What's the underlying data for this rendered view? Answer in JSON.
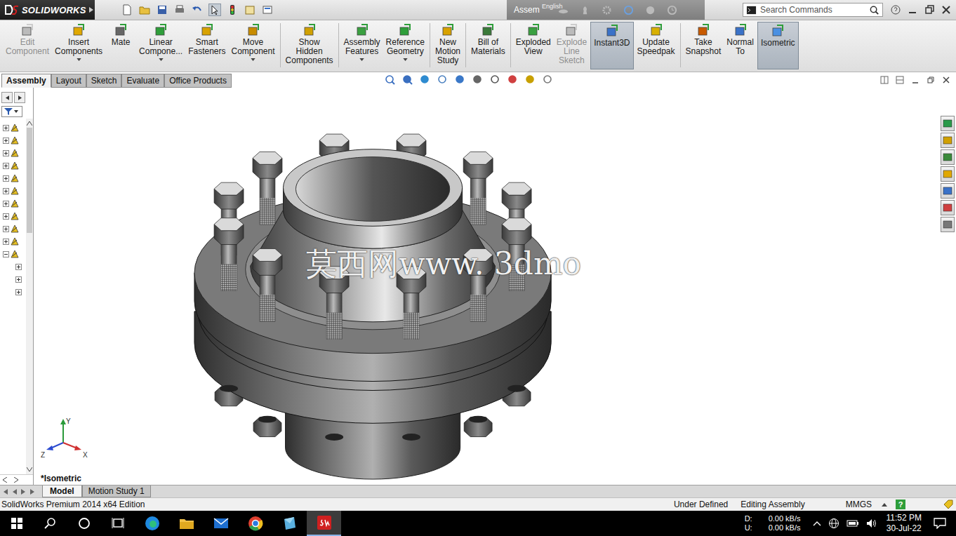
{
  "app": {
    "logo": "SOLIDWORKS",
    "title": "Assem",
    "language_tip": "English",
    "search_placeholder": "Search Commands"
  },
  "commands": [
    {
      "label": "Edit\nComponent",
      "disabled": true,
      "selected": false,
      "dropdown": false,
      "separator_before": false
    },
    {
      "label": "Insert\nComponents",
      "disabled": false,
      "selected": false,
      "dropdown": true,
      "separator_before": false
    },
    {
      "label": "Mate",
      "disabled": false,
      "selected": false,
      "dropdown": false,
      "separator_before": false
    },
    {
      "label": "Linear\nCompone...",
      "disabled": false,
      "selected": false,
      "dropdown": true,
      "separator_before": false
    },
    {
      "label": "Smart\nFasteners",
      "disabled": false,
      "selected": false,
      "dropdown": false,
      "separator_before": false
    },
    {
      "label": "Move\nComponent",
      "disabled": false,
      "selected": false,
      "dropdown": true,
      "separator_before": false
    },
    {
      "label": "Show\nHidden\nComponents",
      "disabled": false,
      "selected": false,
      "dropdown": false,
      "separator_before": true
    },
    {
      "label": "Assembly\nFeatures",
      "disabled": false,
      "selected": false,
      "dropdown": true,
      "separator_before": true
    },
    {
      "label": "Reference\nGeometry",
      "disabled": false,
      "selected": false,
      "dropdown": true,
      "separator_before": false
    },
    {
      "label": "New\nMotion\nStudy",
      "disabled": false,
      "selected": false,
      "dropdown": false,
      "separator_before": true
    },
    {
      "label": "Bill of\nMaterials",
      "disabled": false,
      "selected": false,
      "dropdown": false,
      "separator_before": true
    },
    {
      "label": "Exploded\nView",
      "disabled": false,
      "selected": false,
      "dropdown": false,
      "separator_before": true
    },
    {
      "label": "Explode\nLine\nSketch",
      "disabled": true,
      "selected": false,
      "dropdown": false,
      "separator_before": false
    },
    {
      "label": "Instant3D",
      "disabled": false,
      "selected": true,
      "dropdown": false,
      "separator_before": false
    },
    {
      "label": "Update\nSpeedpak",
      "disabled": false,
      "selected": false,
      "dropdown": false,
      "separator_before": false
    },
    {
      "label": "Take\nSnapshot",
      "disabled": false,
      "selected": false,
      "dropdown": false,
      "separator_before": true
    },
    {
      "label": "Normal\nTo",
      "disabled": false,
      "selected": false,
      "dropdown": false,
      "separator_before": false
    },
    {
      "label": "Isometric",
      "disabled": false,
      "selected": true,
      "dropdown": false,
      "separator_before": false
    }
  ],
  "tabs": [
    {
      "label": "Assembly",
      "selected": true
    },
    {
      "label": "Layout",
      "selected": false
    },
    {
      "label": "Sketch",
      "selected": false
    },
    {
      "label": "Evaluate",
      "selected": false
    },
    {
      "label": "Office Products",
      "selected": false
    }
  ],
  "tree": {
    "items": [
      {
        "expanded": false,
        "child": false
      },
      {
        "expanded": false,
        "child": false
      },
      {
        "expanded": false,
        "child": false
      },
      {
        "expanded": false,
        "child": false
      },
      {
        "expanded": false,
        "child": false
      },
      {
        "expanded": false,
        "child": false
      },
      {
        "expanded": false,
        "child": false
      },
      {
        "expanded": false,
        "child": false
      },
      {
        "expanded": false,
        "child": false
      },
      {
        "expanded": false,
        "child": false
      },
      {
        "expanded": true,
        "child": false
      },
      {
        "expanded": false,
        "child": true
      },
      {
        "expanded": false,
        "child": true
      },
      {
        "expanded": false,
        "child": true
      }
    ]
  },
  "viewport": {
    "watermark": "莫西网www. 3dmo",
    "view_label": "*Isometric",
    "axes": {
      "y": "Y",
      "z": "Z",
      "x": "X"
    }
  },
  "bottom_tabs": [
    {
      "label": "Model",
      "selected": true
    },
    {
      "label": "Motion Study 1",
      "selected": false
    }
  ],
  "status_bar": {
    "edition": "SolidWorks Premium 2014 x64 Edition",
    "state": "Under Defined",
    "mode": "Editing Assembly",
    "units": "MMGS",
    "help": "?"
  },
  "taskbar": {
    "apps": [
      {
        "kind": "edge",
        "active": false
      },
      {
        "kind": "explorer",
        "active": false
      },
      {
        "kind": "mail",
        "active": false
      },
      {
        "kind": "chrome",
        "active": false
      },
      {
        "kind": "tile",
        "active": false
      },
      {
        "kind": "solidworks",
        "active": true
      }
    ],
    "net": [
      {
        "label": "D:",
        "value": "0.00 kB/s"
      },
      {
        "label": "U:",
        "value": "0.00 kB/s"
      }
    ],
    "time": "11:52 PM",
    "date": "30-Jul-22"
  }
}
